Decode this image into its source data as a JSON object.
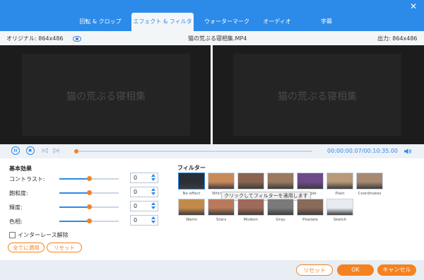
{
  "tabs": [
    {
      "label": "回転 & クロップ"
    },
    {
      "label": "エフェクト & フィルター"
    },
    {
      "label": "ウォーターマーク"
    },
    {
      "label": "オーディオ"
    },
    {
      "label": "字幕"
    }
  ],
  "active_tab": "エフェクト & フィルター",
  "info": {
    "original": "オリジナル: 864x486",
    "filename": "猫の荒ぶる寝相集.MP4",
    "output": "出力: 864x486"
  },
  "preview": {
    "left_title": "猫の荒ぶる寝相集",
    "right_title": "猫の荒ぶる寝相集"
  },
  "playback": {
    "time": "00:00:00.07/00:10:35.00",
    "progress": 0.005
  },
  "basic": {
    "title": "基本効果",
    "rows": [
      {
        "label": "コントラスト:",
        "value": "0",
        "level": 0.5
      },
      {
        "label": "飽和度:",
        "value": "0",
        "level": 0.5
      },
      {
        "label": "輝度:",
        "value": "0",
        "level": 0.5
      },
      {
        "label": "色相:",
        "value": "0",
        "level": 0.5
      }
    ],
    "deinterlace": "インターレース解除",
    "apply_all": "全てに適用",
    "reset": "リセット"
  },
  "filters": {
    "title": "フィルター",
    "tooltip": "クリックしてフィルターを適用します",
    "row1": [
      {
        "label": "No effect",
        "color": "#2a2f36"
      },
      {
        "label": "Whirlpool",
        "color": "#c98a5a"
      },
      {
        "label": "",
        "color": "#8a6450"
      },
      {
        "label": "",
        "color": "#9a7a60"
      },
      {
        "label": "Purple",
        "color": "#6e4a8a"
      },
      {
        "label": "Plain",
        "color": "#b89a78"
      },
      {
        "label": "Coordinates",
        "color": "#a88a70"
      }
    ],
    "row2": [
      {
        "label": "Warm",
        "color": "#c48a4a"
      },
      {
        "label": "Stars",
        "color": "#b87a5a"
      },
      {
        "label": "Modern",
        "color": "#a06a5a"
      },
      {
        "label": "Gray",
        "color": "#7a7a7a"
      },
      {
        "label": "Pixelate",
        "color": "#8a6a58"
      },
      {
        "label": "Sketch",
        "color": "#e8ecf0"
      }
    ]
  },
  "footer": {
    "reset": "リセット",
    "ok": "OK",
    "cancel": "キャンセル"
  }
}
